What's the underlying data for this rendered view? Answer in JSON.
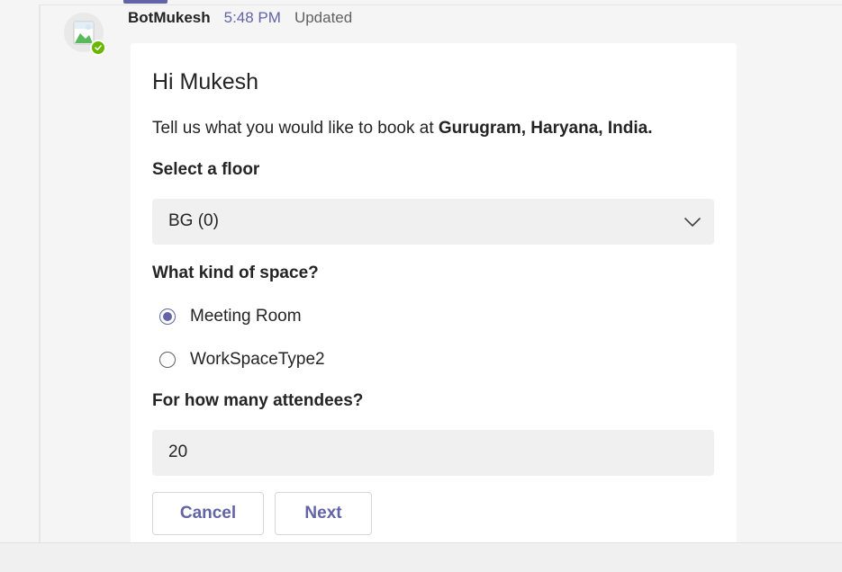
{
  "message": {
    "sender": "BotMukesh",
    "time": "5:48 PM",
    "status": "Updated"
  },
  "card": {
    "greeting": "Hi Mukesh",
    "intro_prefix": "Tell us what you would like to book at ",
    "intro_location": "Gurugram, Haryana, India.",
    "floor_label": "Select a floor",
    "floor_selected": "BG (0)",
    "space_label": "What kind of space?",
    "space_options": [
      {
        "label": "Meeting Room",
        "checked": true
      },
      {
        "label": "WorkSpaceType2",
        "checked": false
      }
    ],
    "attendees_label": "For how many attendees?",
    "attendees_value": "20",
    "cancel_label": "Cancel",
    "next_label": "Next"
  },
  "colors": {
    "accent": "#6264a7",
    "presence_available": "#6bb700",
    "input_bg": "#f0f0f0"
  },
  "icons": {
    "dropdown": "chevron-down-icon",
    "avatar": "bot-avatar-icon",
    "presence": "available-check-icon"
  }
}
